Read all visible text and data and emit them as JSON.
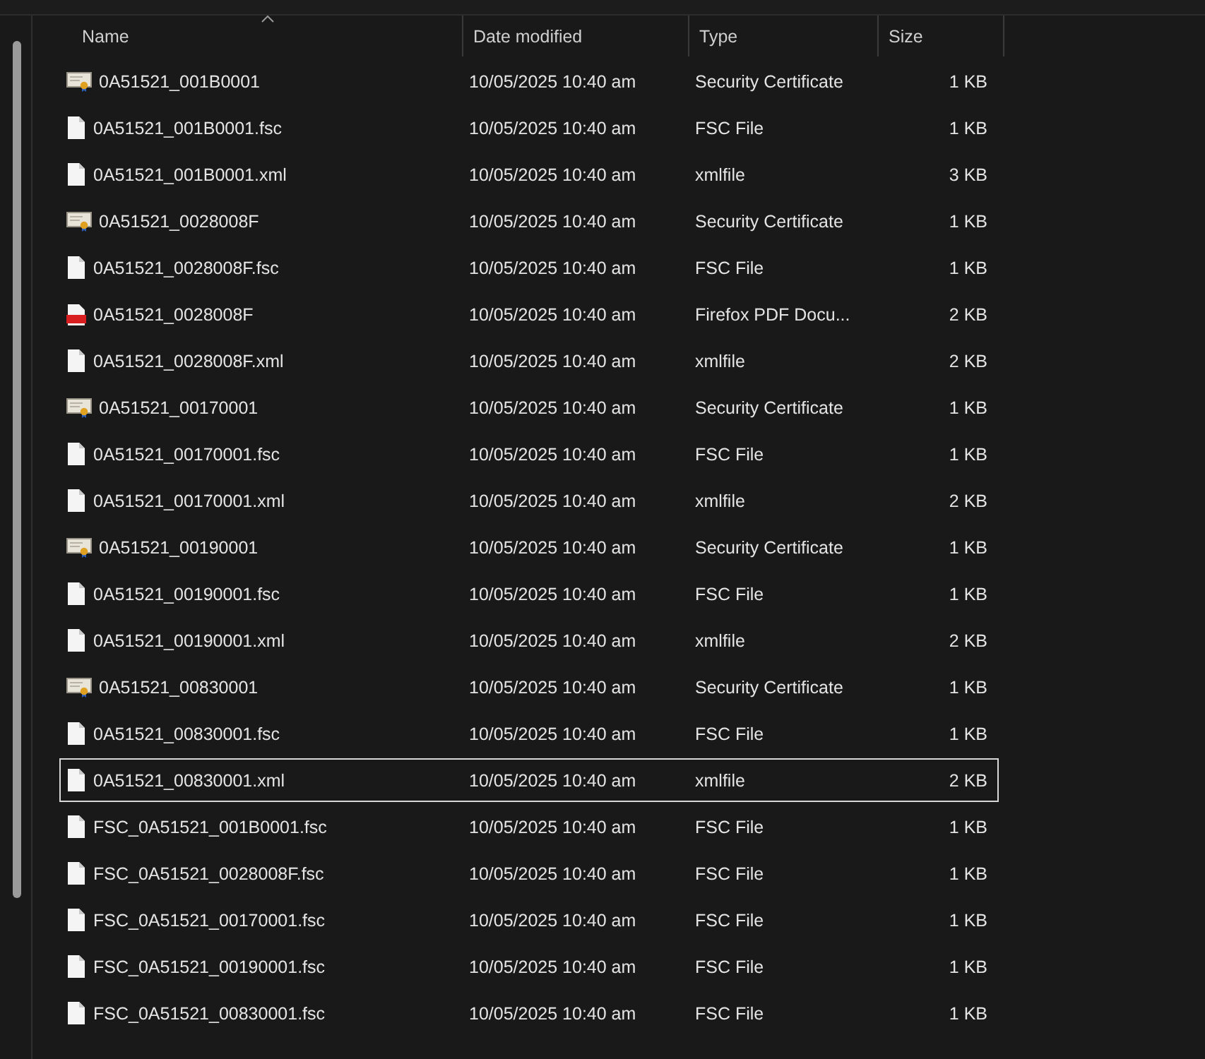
{
  "columns": [
    {
      "label": "Name",
      "sorted": true
    },
    {
      "label": "Date modified",
      "sorted": false
    },
    {
      "label": "Type",
      "sorted": false
    },
    {
      "label": "Size",
      "sorted": false
    }
  ],
  "files": [
    {
      "name": "0A51521_001B0001",
      "kind": "certificate",
      "date": "10/05/2025 10:40 am",
      "type": "Security Certificate",
      "size": "1 KB",
      "focused": false
    },
    {
      "name": "0A51521_001B0001.fsc",
      "kind": "file",
      "date": "10/05/2025 10:40 am",
      "type": "FSC File",
      "size": "1 KB",
      "focused": false
    },
    {
      "name": "0A51521_001B0001.xml",
      "kind": "file",
      "date": "10/05/2025 10:40 am",
      "type": "xmlfile",
      "size": "3 KB",
      "focused": false
    },
    {
      "name": "0A51521_0028008F",
      "kind": "certificate",
      "date": "10/05/2025 10:40 am",
      "type": "Security Certificate",
      "size": "1 KB",
      "focused": false
    },
    {
      "name": "0A51521_0028008F.fsc",
      "kind": "file",
      "date": "10/05/2025 10:40 am",
      "type": "FSC File",
      "size": "1 KB",
      "focused": false
    },
    {
      "name": "0A51521_0028008F",
      "kind": "pdf",
      "date": "10/05/2025 10:40 am",
      "type": "Firefox PDF Docu...",
      "size": "2 KB",
      "focused": false
    },
    {
      "name": "0A51521_0028008F.xml",
      "kind": "file",
      "date": "10/05/2025 10:40 am",
      "type": "xmlfile",
      "size": "2 KB",
      "focused": false
    },
    {
      "name": "0A51521_00170001",
      "kind": "certificate",
      "date": "10/05/2025 10:40 am",
      "type": "Security Certificate",
      "size": "1 KB",
      "focused": false
    },
    {
      "name": "0A51521_00170001.fsc",
      "kind": "file",
      "date": "10/05/2025 10:40 am",
      "type": "FSC File",
      "size": "1 KB",
      "focused": false
    },
    {
      "name": "0A51521_00170001.xml",
      "kind": "file",
      "date": "10/05/2025 10:40 am",
      "type": "xmlfile",
      "size": "2 KB",
      "focused": false
    },
    {
      "name": "0A51521_00190001",
      "kind": "certificate",
      "date": "10/05/2025 10:40 am",
      "type": "Security Certificate",
      "size": "1 KB",
      "focused": false
    },
    {
      "name": "0A51521_00190001.fsc",
      "kind": "file",
      "date": "10/05/2025 10:40 am",
      "type": "FSC File",
      "size": "1 KB",
      "focused": false
    },
    {
      "name": "0A51521_00190001.xml",
      "kind": "file",
      "date": "10/05/2025 10:40 am",
      "type": "xmlfile",
      "size": "2 KB",
      "focused": false
    },
    {
      "name": "0A51521_00830001",
      "kind": "certificate",
      "date": "10/05/2025 10:40 am",
      "type": "Security Certificate",
      "size": "1 KB",
      "focused": false
    },
    {
      "name": "0A51521_00830001.fsc",
      "kind": "file",
      "date": "10/05/2025 10:40 am",
      "type": "FSC File",
      "size": "1 KB",
      "focused": false
    },
    {
      "name": "0A51521_00830001.xml",
      "kind": "file",
      "date": "10/05/2025 10:40 am",
      "type": "xmlfile",
      "size": "2 KB",
      "focused": true
    },
    {
      "name": "FSC_0A51521_001B0001.fsc",
      "kind": "file",
      "date": "10/05/2025 10:40 am",
      "type": "FSC File",
      "size": "1 KB",
      "focused": false
    },
    {
      "name": "FSC_0A51521_0028008F.fsc",
      "kind": "file",
      "date": "10/05/2025 10:40 am",
      "type": "FSC File",
      "size": "1 KB",
      "focused": false
    },
    {
      "name": "FSC_0A51521_00170001.fsc",
      "kind": "file",
      "date": "10/05/2025 10:40 am",
      "type": "FSC File",
      "size": "1 KB",
      "focused": false
    },
    {
      "name": "FSC_0A51521_00190001.fsc",
      "kind": "file",
      "date": "10/05/2025 10:40 am",
      "type": "FSC File",
      "size": "1 KB",
      "focused": false
    },
    {
      "name": "FSC_0A51521_00830001.fsc",
      "kind": "file",
      "date": "10/05/2025 10:40 am",
      "type": "FSC File",
      "size": "1 KB",
      "focused": false
    }
  ]
}
